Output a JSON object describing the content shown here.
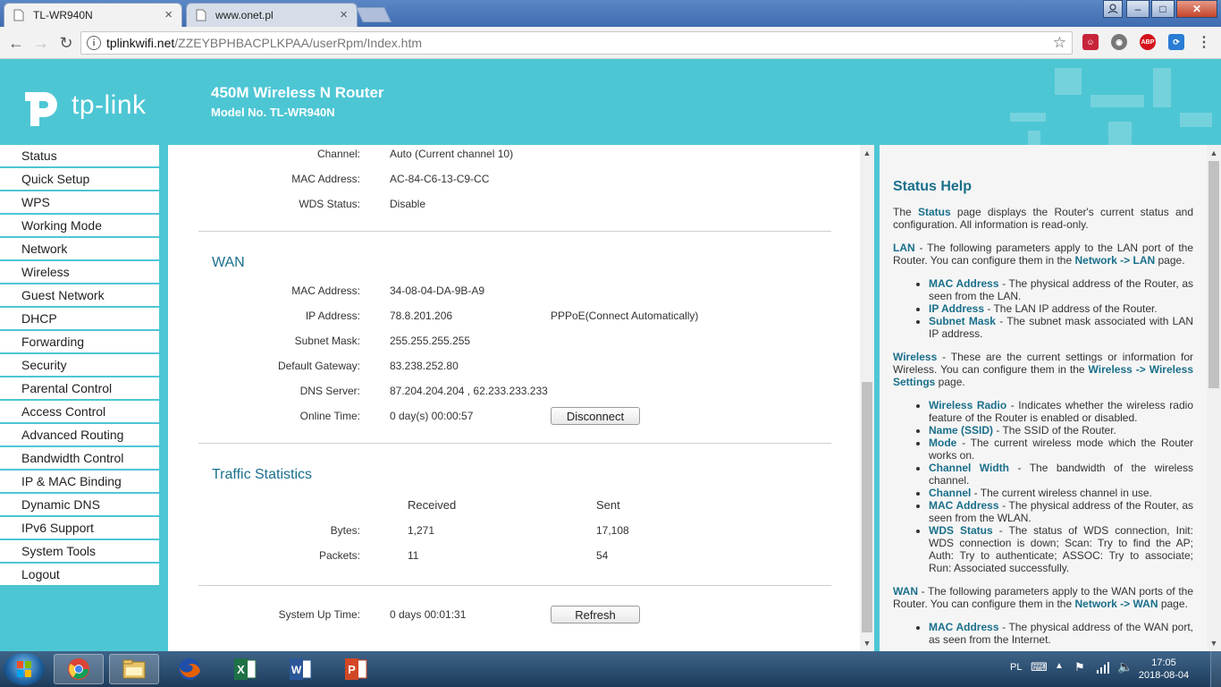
{
  "browser": {
    "tabs": [
      {
        "title": "TL-WR940N",
        "active": true
      },
      {
        "title": "www.onet.pl",
        "active": false
      }
    ],
    "url_host": "tplinkwifi.net",
    "url_path": "/ZZEYBPHBACPLKPAA/userRpm/Index.htm",
    "window_controls": {
      "minimize": "–",
      "maximize": "□",
      "close": "✕"
    },
    "extension_labels": {
      "abp": "ABP"
    }
  },
  "header": {
    "logo_text": "tp-link",
    "product": "450M Wireless N Router",
    "model": "Model No. TL-WR940N"
  },
  "menu": [
    "Status",
    "Quick Setup",
    "WPS",
    "Working Mode",
    "Network",
    "Wireless",
    "Guest Network",
    "DHCP",
    "Forwarding",
    "Security",
    "Parental Control",
    "Access Control",
    "Advanced Routing",
    "Bandwidth Control",
    "IP & MAC Binding",
    "Dynamic DNS",
    "IPv6 Support",
    "System Tools",
    "Logout"
  ],
  "wireless": {
    "channel_label": "Channel:",
    "channel": "Auto (Current channel 10)",
    "mac_label": "MAC Address:",
    "mac": "AC-84-C6-13-C9-CC",
    "wds_label": "WDS Status:",
    "wds": "Disable"
  },
  "wan": {
    "title": "WAN",
    "mac_label": "MAC Address:",
    "mac": "34-08-04-DA-9B-A9",
    "ip_label": "IP Address:",
    "ip": "78.8.201.206",
    "connection_type": "PPPoE(Connect Automatically)",
    "subnet_label": "Subnet Mask:",
    "subnet": "255.255.255.255",
    "gateway_label": "Default Gateway:",
    "gateway": "83.238.252.80",
    "dns_label": "DNS Server:",
    "dns": "87.204.204.204 , 62.233.233.233",
    "online_label": "Online Time:",
    "online": "0 day(s) 00:00:57",
    "disconnect_button": "Disconnect"
  },
  "traffic": {
    "title": "Traffic Statistics",
    "col_received": "Received",
    "col_sent": "Sent",
    "bytes_label": "Bytes:",
    "bytes_received": "1,271",
    "bytes_sent": "17,108",
    "packets_label": "Packets:",
    "packets_received": "11",
    "packets_sent": "54"
  },
  "system": {
    "uptime_label": "System Up Time:",
    "uptime": "0 days 00:01:31",
    "refresh_button": "Refresh"
  },
  "help": {
    "title": "Status Help",
    "p1_a": "The ",
    "p1_b": "Status",
    "p1_c": " page displays the Router's current status and configuration. All information is read-only.",
    "lan_a": "LAN",
    "lan_b": " - The following parameters apply to the LAN port of the Router. You can configure them in the ",
    "lan_c": "Network -> LAN",
    "lan_d": " page.",
    "lan_items": [
      {
        "term": "MAC Address",
        "desc": " - The physical address of the Router, as seen from the LAN."
      },
      {
        "term": "IP Address",
        "desc": " - The LAN IP address of the Router."
      },
      {
        "term": "Subnet Mask",
        "desc": " - The subnet mask associated with LAN IP address."
      }
    ],
    "wl_a": "Wireless",
    "wl_b": " - These are the current settings or information for Wireless. You can configure them in the ",
    "wl_c": "Wireless -> Wireless Settings",
    "wl_d": " page.",
    "wl_items": [
      {
        "term": "Wireless Radio",
        "desc": " - Indicates whether the wireless radio feature of the Router is enabled or disabled."
      },
      {
        "term": "Name (SSID)",
        "desc": " - The SSID of the Router."
      },
      {
        "term": "Mode",
        "desc": " - The current wireless mode which the Router works on."
      },
      {
        "term": "Channel Width",
        "desc": " - The bandwidth of the wireless channel."
      },
      {
        "term": "Channel",
        "desc": " - The current wireless channel in use."
      },
      {
        "term": "MAC Address",
        "desc": " - The physical address of the Router, as seen from the WLAN."
      },
      {
        "term": "WDS Status",
        "desc": " - The status of WDS connection, Init: WDS connection is down; Scan: Try to find the AP; Auth: Try to authenticate; ASSOC: Try to associate; Run: Associated successfully."
      }
    ],
    "wan_a": "WAN",
    "wan_b": " - The following parameters apply to the WAN ports of the Router. You can configure them in the ",
    "wan_c": "Network -> WAN",
    "wan_d": " page.",
    "wan_items": [
      {
        "term": "MAC Address",
        "desc": " - The physical address of the WAN port, as seen from the Internet."
      }
    ]
  },
  "taskbar": {
    "language": "PL",
    "time": "17:05",
    "date": "2018-08-04"
  },
  "colors": {
    "accent": "#4dc6d4",
    "heading": "#1a6f8b"
  }
}
